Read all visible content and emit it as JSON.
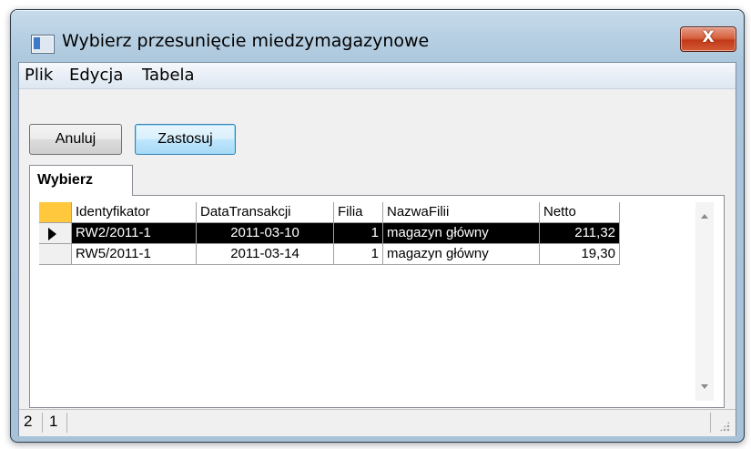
{
  "window": {
    "title": "Wybierz przesunięcie miedzymagazynowe",
    "close_label": "X"
  },
  "menu": {
    "items": [
      "Plik",
      "Edycja",
      "Tabela"
    ]
  },
  "toolbar": {
    "cancel_label": "Anuluj",
    "apply_label": "Zastosuj"
  },
  "tabs": [
    {
      "label": "Wybierz"
    }
  ],
  "grid": {
    "columns": [
      "Identyfikator",
      "DataTransakcji",
      "Filia",
      "NazwaFilii",
      "Netto"
    ],
    "rows": [
      {
        "id": "RW2/2011-1",
        "date": "2011-03-10",
        "filia": "1",
        "name": "magazyn główny",
        "netto": "211,32",
        "selected": true
      },
      {
        "id": "RW5/2011-1",
        "date": "2011-03-14",
        "filia": "1",
        "name": "magazyn główny",
        "netto": "19,30",
        "selected": false
      }
    ]
  },
  "status": {
    "left": "2",
    "right": "1"
  },
  "colors": {
    "selection_bg": "#000000",
    "corner_cell": "#ffc83d",
    "close_button": "#c2391a"
  }
}
